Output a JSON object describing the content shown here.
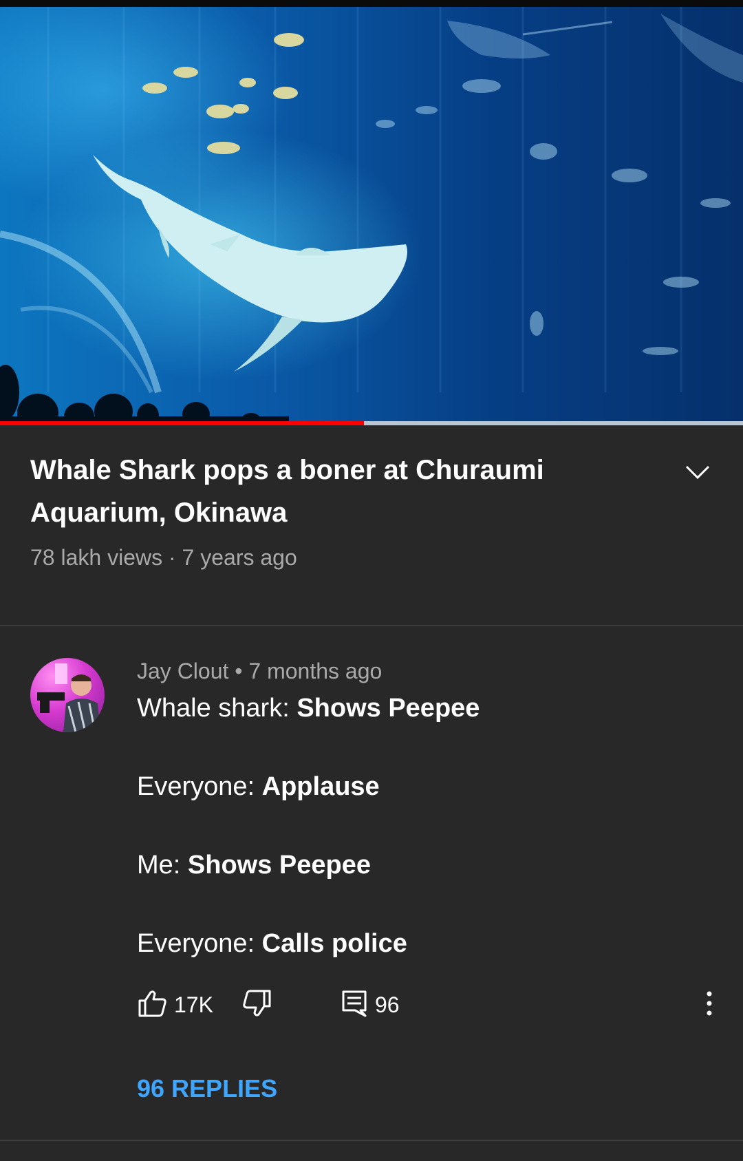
{
  "video": {
    "progress_fraction": 0.49,
    "accent_color": "#ff0000"
  },
  "title": {
    "text": "Whale Shark pops a boner at Churaumi Aquarium, Okinawa",
    "meta": "78 lakh views · 7 years ago",
    "expand_icon": "chevron-down-icon"
  },
  "comment": {
    "author": "Jay Clout",
    "separator": " • ",
    "time": "7 months ago",
    "lines": [
      {
        "speaker": "Whale shark: ",
        "action": "Shows Peepee"
      },
      {
        "speaker": "Everyone: ",
        "action": "Applause"
      },
      {
        "speaker": "Me: ",
        "action": "Shows Peepee"
      },
      {
        "speaker": "Everyone: ",
        "action": "Calls police"
      }
    ],
    "likes": "17K",
    "reply_count": "96",
    "replies_label": "96 REPLIES",
    "replies_color": "#3ea6ff",
    "icons": [
      "thumbs-up-icon",
      "thumbs-down-icon",
      "comment-icon",
      "more-vertical-icon"
    ]
  }
}
